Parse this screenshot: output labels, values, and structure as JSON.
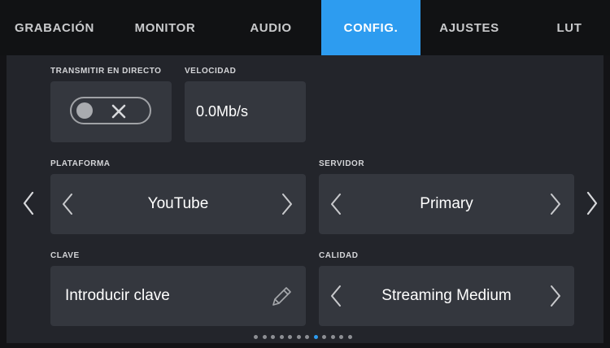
{
  "tabs": [
    {
      "label": "GRABACIÓN",
      "active": false
    },
    {
      "label": "MONITOR",
      "active": false
    },
    {
      "label": "AUDIO",
      "active": false
    },
    {
      "label": "CONFIG.",
      "active": true
    },
    {
      "label": "AJUSTES",
      "active": false
    },
    {
      "label": "LUT",
      "active": false
    }
  ],
  "stream": {
    "label": "TRANSMITIR EN DIRECTO",
    "toggle_on": false,
    "toggle_icons": [
      "circle-knob-icon",
      "x-icon"
    ]
  },
  "speed": {
    "label": "VELOCIDAD",
    "value": "0.0Mb/s"
  },
  "platform": {
    "label": "PLATAFORMA",
    "value": "YouTube"
  },
  "server": {
    "label": "SERVIDOR",
    "value": "Primary"
  },
  "key": {
    "label": "CLAVE",
    "value": "Introducir clave",
    "icon": "pencil-icon"
  },
  "quality": {
    "label": "CALIDAD",
    "value": "Streaming Medium"
  },
  "pagination": {
    "total": 12,
    "current": 8
  },
  "colors": {
    "accent": "#2d9cf0",
    "panel": "#23252b",
    "box": "#34373e",
    "tabbar": "#111214"
  }
}
